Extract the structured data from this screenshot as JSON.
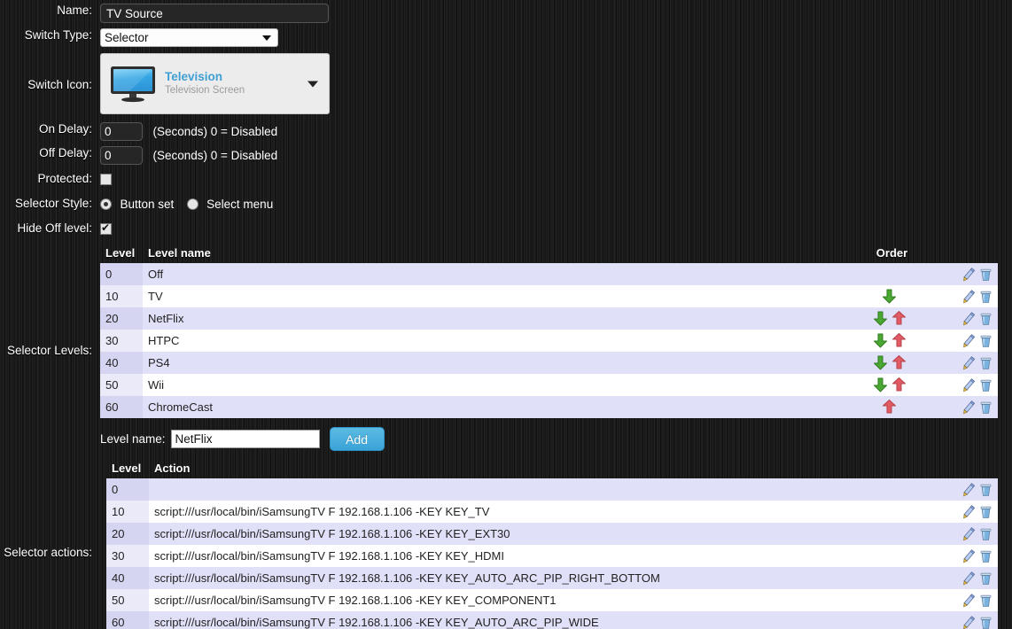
{
  "form": {
    "name_label": "Name:",
    "name_value": "TV Source",
    "switch_type_label": "Switch Type:",
    "switch_type_value": "Selector",
    "switch_icon_label": "Switch Icon:",
    "icon_title": "Television",
    "icon_subtitle": "Television Screen",
    "on_delay_label": "On Delay:",
    "on_delay_value": "0",
    "on_delay_hint": "(Seconds) 0 = Disabled",
    "off_delay_label": "Off Delay:",
    "off_delay_value": "0",
    "off_delay_hint": "(Seconds) 0 = Disabled",
    "protected_label": "Protected:",
    "selector_style_label": "Selector Style:",
    "style_option_buttonset": "Button set",
    "style_option_selectmenu": "Select menu",
    "hide_off_label": "Hide Off level:"
  },
  "levels": {
    "section_label": "Selector Levels:",
    "headers": {
      "level": "Level",
      "name": "Level name",
      "order": "Order"
    },
    "rows": [
      {
        "level": "0",
        "name": "Off",
        "down": false,
        "up": false
      },
      {
        "level": "10",
        "name": "TV",
        "down": true,
        "up": false
      },
      {
        "level": "20",
        "name": "NetFlix",
        "down": true,
        "up": true
      },
      {
        "level": "30",
        "name": "HTPC",
        "down": true,
        "up": true
      },
      {
        "level": "40",
        "name": "PS4",
        "down": true,
        "up": true
      },
      {
        "level": "50",
        "name": "Wii",
        "down": true,
        "up": true
      },
      {
        "level": "60",
        "name": "ChromeCast",
        "down": false,
        "up": true
      }
    ],
    "add": {
      "caption": "Level name:",
      "value": "NetFlix",
      "button_label": "Add"
    }
  },
  "actions": {
    "section_label": "Selector actions:",
    "headers": {
      "level": "Level",
      "action": "Action"
    },
    "rows": [
      {
        "level": "0",
        "action": ""
      },
      {
        "level": "10",
        "action": "script:///usr/local/bin/iSamsungTV F 192.168.1.106 -KEY KEY_TV"
      },
      {
        "level": "20",
        "action": "script:///usr/local/bin/iSamsungTV F 192.168.1.106 -KEY KEY_EXT30"
      },
      {
        "level": "30",
        "action": "script:///usr/local/bin/iSamsungTV F 192.168.1.106 -KEY KEY_HDMI"
      },
      {
        "level": "40",
        "action": "script:///usr/local/bin/iSamsungTV F 192.168.1.106 -KEY KEY_AUTO_ARC_PIP_RIGHT_BOTTOM"
      },
      {
        "level": "50",
        "action": "script:///usr/local/bin/iSamsungTV F 192.168.1.106 -KEY KEY_COMPONENT1"
      },
      {
        "level": "60",
        "action": "script:///usr/local/bin/iSamsungTV F 192.168.1.106 -KEY KEY_AUTO_ARC_PIP_WIDE"
      }
    ]
  },
  "icons": {
    "edit": "pencil-icon",
    "delete": "trash-icon",
    "move_down": "arrow-down-icon",
    "move_up": "arrow-up-icon",
    "dropdown": "chevron-down-icon",
    "device": "television-icon"
  },
  "colors": {
    "accent": "#3f9fd4",
    "row_alt": "#e0e0f8",
    "level_cell": "#d5d5f2",
    "arrow_down": "#4aa832",
    "arrow_up": "#e05b63"
  }
}
